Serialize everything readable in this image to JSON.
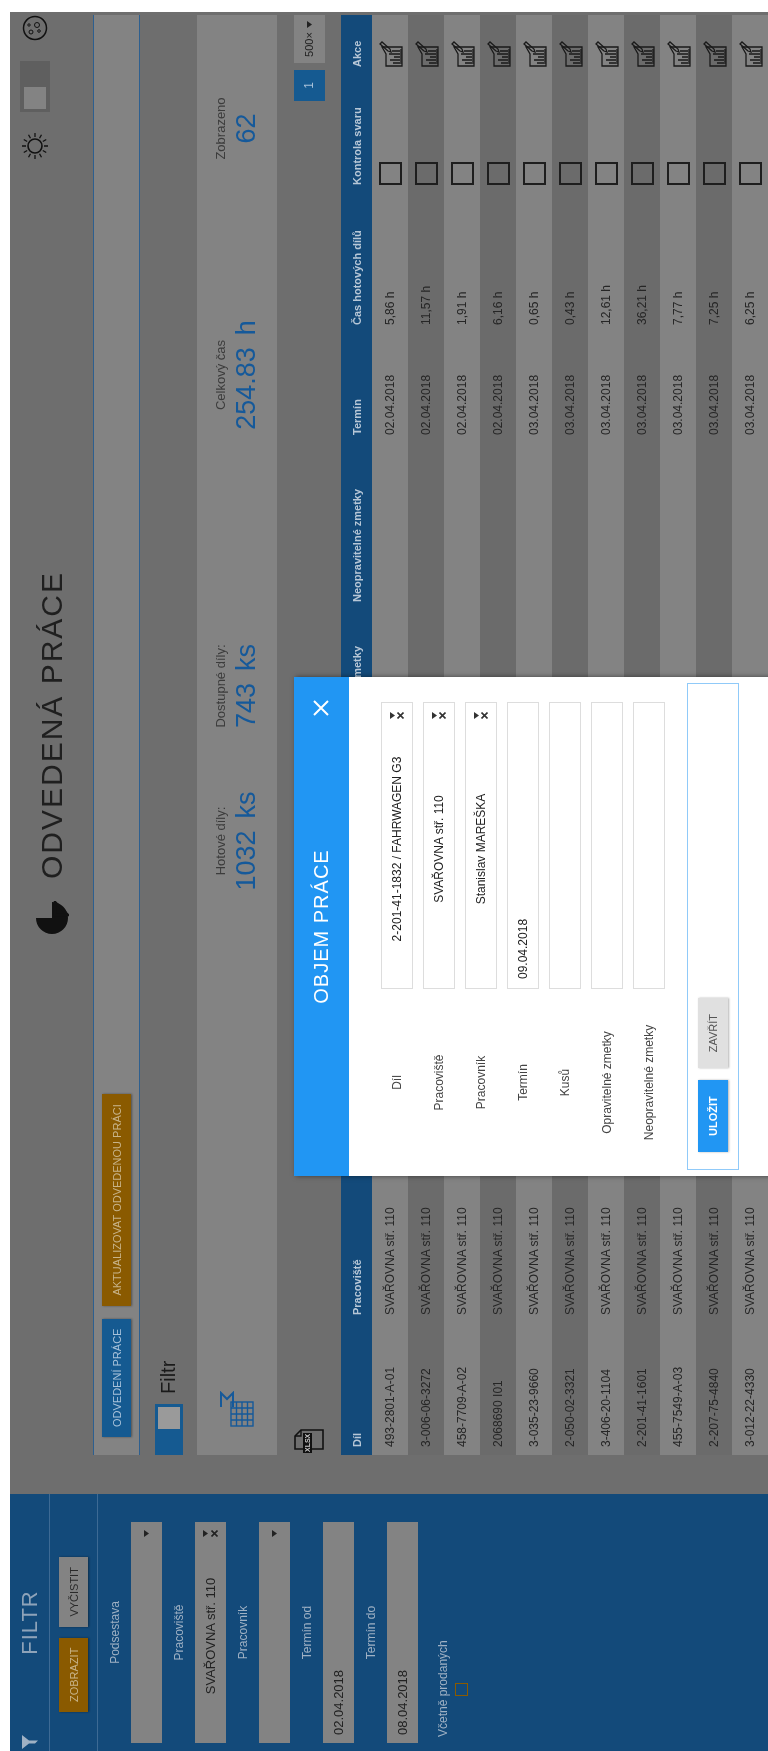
{
  "sidebar": {
    "title": "FILTR",
    "buttons": [
      {
        "label": "ZOBRAZIT",
        "kind": "warning"
      },
      {
        "label": "VYČISTIT",
        "kind": "default"
      }
    ],
    "fields": [
      {
        "label": "Podsestava",
        "kind": "select",
        "clearable": false
      },
      {
        "label": "Pracoviště",
        "kind": "select",
        "value": "SVAŘOVNA stř. 110",
        "clearable": true
      },
      {
        "label": "Pracovník",
        "kind": "select",
        "clearable": false
      },
      {
        "label": "Termín od",
        "kind": "date",
        "value": "02.04.2018"
      },
      {
        "label": "Termín do",
        "kind": "date",
        "value": "08.04.2018"
      }
    ],
    "include_sold": {
      "label": "Včetně prodaných",
      "checked": false
    }
  },
  "header": {
    "title": "ODVEDENÁ PRÁCE",
    "theme_toggle": {
      "on": false
    }
  },
  "toolbar": {
    "buttons": [
      {
        "label": "ODVEDENÍ PRÁCE",
        "kind": "primary"
      },
      {
        "label": "AKTUALIZOVAT ODVEDENOU PRÁCI",
        "kind": "warning"
      }
    ]
  },
  "filter_toggle": {
    "label": "Filtr",
    "on": true
  },
  "stats": [
    {
      "label": "Hotové díly:",
      "value": "1032",
      "unit": "ks"
    },
    {
      "label": "Dostupné díly:",
      "value": "743",
      "unit": "ks"
    },
    {
      "label": "Celkový čas",
      "value": "254.83",
      "unit": "h"
    },
    {
      "label": "Zobrazeno",
      "value": "62"
    }
  ],
  "export": {
    "label": "XLSX"
  },
  "pagination": {
    "pages": [
      {
        "label": "1",
        "selected": true
      }
    ],
    "page_size": "500×"
  },
  "table": {
    "columns": [
      {
        "label": "Díl"
      },
      {
        "label": "Pracoviště"
      },
      {
        "label": "metky"
      },
      {
        "label": "Neopravitelné zmetky"
      },
      {
        "label": "Termín"
      },
      {
        "label": "Čas hotových dílů"
      },
      {
        "label": "Kontrola svaru"
      },
      {
        "label": "Akce"
      }
    ],
    "rows": [
      {
        "dil": "493-2801-A-01",
        "pracoviste": "SVAŘOVNA stř. 110",
        "termin": "02.04.2018",
        "cas": "5,86 h",
        "kontrola": false
      },
      {
        "dil": "3-006-06-3272",
        "pracoviste": "SVAŘOVNA stř. 110",
        "termin": "02.04.2018",
        "cas": "11,57 h",
        "kontrola": false
      },
      {
        "dil": "458-7709-A-02",
        "pracoviste": "SVAŘOVNA stř. 110",
        "termin": "02.04.2018",
        "cas": "1,91 h",
        "kontrola": false
      },
      {
        "dil": "2068690 I01",
        "pracoviste": "SVAŘOVNA stř. 110",
        "termin": "02.04.2018",
        "cas": "6,16 h",
        "kontrola": false
      },
      {
        "dil": "3-035-23-9660",
        "pracoviste": "SVAŘOVNA stř. 110",
        "termin": "03.04.2018",
        "cas": "0,65 h",
        "kontrola": false
      },
      {
        "dil": "2-050-02-3321",
        "pracoviste": "SVAŘOVNA stř. 110",
        "termin": "03.04.2018",
        "cas": "0,43 h",
        "kontrola": false
      },
      {
        "dil": "3-406-20-1104",
        "pracoviste": "SVAŘOVNA stř. 110",
        "termin": "03.04.2018",
        "cas": "12,61 h",
        "kontrola": false
      },
      {
        "dil": "2-201-41-1601",
        "pracoviste": "SVAŘOVNA stř. 110",
        "termin": "03.04.2018",
        "cas": "36,21 h",
        "kontrola": false
      },
      {
        "dil": "455-7549-A-03",
        "pracoviste": "SVAŘOVNA stř. 110",
        "termin": "03.04.2018",
        "cas": "7,77 h",
        "kontrola": false
      },
      {
        "dil": "2-207-75-4840",
        "pracoviste": "SVAŘOVNA stř. 110",
        "termin": "03.04.2018",
        "cas": "7,25 h",
        "kontrola": false
      },
      {
        "dil": "3-012-22-4330",
        "pracoviste": "SVAŘOVNA stř. 110",
        "termin": "03.04.2018",
        "cas": "6,25 h",
        "kontrola": false
      }
    ]
  },
  "dialog": {
    "title": "OBJEM PRÁCE",
    "fields": [
      {
        "label": "Díl",
        "kind": "select",
        "value": "2-201-41-1832 / FAHRWAGEN G3",
        "clearable": true
      },
      {
        "label": "Pracoviště",
        "kind": "select",
        "value": "SVAŘOVNA stř. 110",
        "clearable": true
      },
      {
        "label": "Pracovník",
        "kind": "select",
        "value": "Stanislav MAREŠKA",
        "clearable": true
      },
      {
        "label": "Termín",
        "kind": "input",
        "value": "09.04.2018"
      },
      {
        "label": "Kusů",
        "kind": "input"
      },
      {
        "label": "Opravitelné zmetky",
        "kind": "input"
      },
      {
        "label": "Neopravitelné zmetky",
        "kind": "input"
      }
    ],
    "buttons": [
      {
        "label": "ULOŽIT",
        "kind": "primary"
      },
      {
        "label": "ZAVŘÍT",
        "kind": "default"
      }
    ]
  }
}
